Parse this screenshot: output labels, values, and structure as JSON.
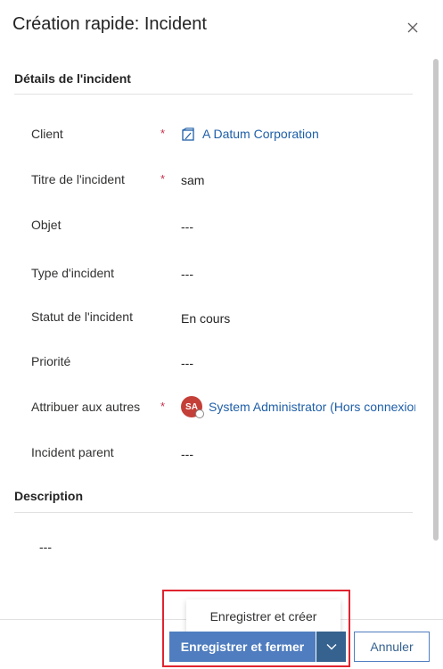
{
  "header": {
    "title": "Création rapide: Incident"
  },
  "sections": {
    "details_title": "Détails de l'incident",
    "description_title": "Description"
  },
  "fields": {
    "client": {
      "label": "Client",
      "required": "*",
      "value": "A Datum Corporation"
    },
    "titre": {
      "label": "Titre de l'incident",
      "required": "*",
      "value": "sam"
    },
    "objet": {
      "label": "Objet",
      "value": "---"
    },
    "type": {
      "label": "Type d'incident",
      "value": "---"
    },
    "statut": {
      "label": "Statut de l'incident",
      "value": "En cours"
    },
    "priorite": {
      "label": "Priorité",
      "value": "---"
    },
    "attribuer": {
      "label": "Attribuer aux autres",
      "required": "*",
      "avatar_initials": "SA",
      "value": "System Administrator (Hors connexion)"
    },
    "parent": {
      "label": "Incident parent",
      "value": "---"
    }
  },
  "description": {
    "value": "---"
  },
  "footer": {
    "flyout_label": "Enregistrer et créer",
    "save_close_label": "Enregistrer et fermer",
    "cancel_label": "Annuler"
  },
  "colors": {
    "accent": "#4f7dbf",
    "accent_dark": "#35628f",
    "required": "#c4314b",
    "link": "#1f5fa8",
    "avatar": "#c43f38",
    "highlight": "#e0242f"
  },
  "icons": {
    "close": "close-icon",
    "lookup": "account-entity-icon",
    "dropdown": "chevron-down-icon"
  }
}
